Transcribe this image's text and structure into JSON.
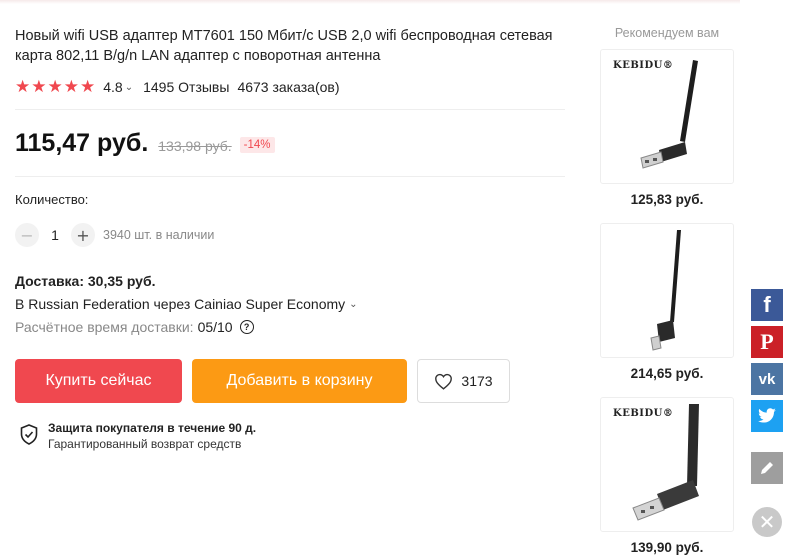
{
  "product": {
    "title": "Новый wifi USB адаптер MT7601 150 Мбит/с USB 2,0 wifi беспроводная сетевая карта 802,11 B/g/n LAN адаптер с поворотная антенна",
    "rating": "4.8",
    "reviews": "1495 Отзывы",
    "orders": "4673 заказа(ов)",
    "price": "115,47 руб.",
    "old_price": "133,98 руб.",
    "discount": "-14%"
  },
  "quantity": {
    "label": "Количество:",
    "minus": "−",
    "value": "1",
    "plus": "+",
    "stock": "3940 шт. в наличии"
  },
  "shipping": {
    "title": "Доставка: 30,35 руб.",
    "route": "В Russian Federation через Cainiao Super Economy",
    "eta_label": "Расчётное время доставки:",
    "eta_date": "05/10",
    "help": "?"
  },
  "actions": {
    "buy_now": "Купить сейчас",
    "add_to_cart": "Добавить в корзину",
    "wishlist_count": "3173"
  },
  "protection": {
    "title": "Защита покупателя в течение 90 д.",
    "subtitle": "Гарантированный возврат средств"
  },
  "recommendations": {
    "title": "Рекомендуем вам",
    "items": [
      {
        "price": "125,83 руб.",
        "brand": "KEBIDU®"
      },
      {
        "price": "214,65 руб.",
        "brand": ""
      },
      {
        "price": "139,90 руб.",
        "brand": "KEBIDU®"
      }
    ]
  },
  "share": {
    "facebook": "f",
    "pinterest": "P",
    "vk": "vk",
    "colors": {
      "facebook": "#3b5998",
      "pinterest": "#cb2027",
      "vk": "#4c75a3",
      "twitter": "#1da1f2",
      "edit": "#9e9e9e",
      "close": "#c9c9c9"
    }
  },
  "colors": {
    "accent_red": "#f0484f",
    "accent_orange": "#fc9a14",
    "star": "#f0484f"
  }
}
